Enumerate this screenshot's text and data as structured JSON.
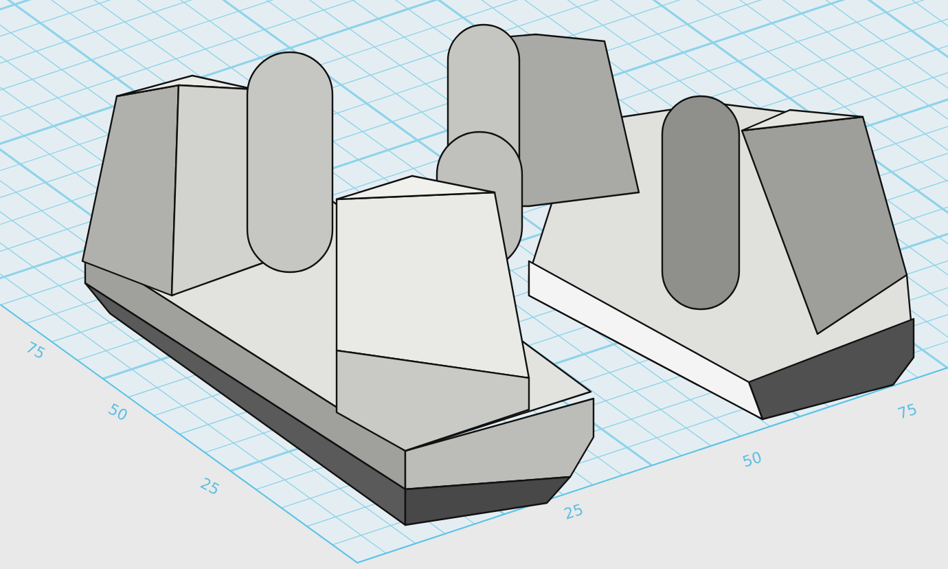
{
  "viewport": {
    "axis_left_labels": [
      "75",
      "50",
      "25"
    ],
    "axis_right_labels": [
      "25",
      "50",
      "75"
    ]
  }
}
